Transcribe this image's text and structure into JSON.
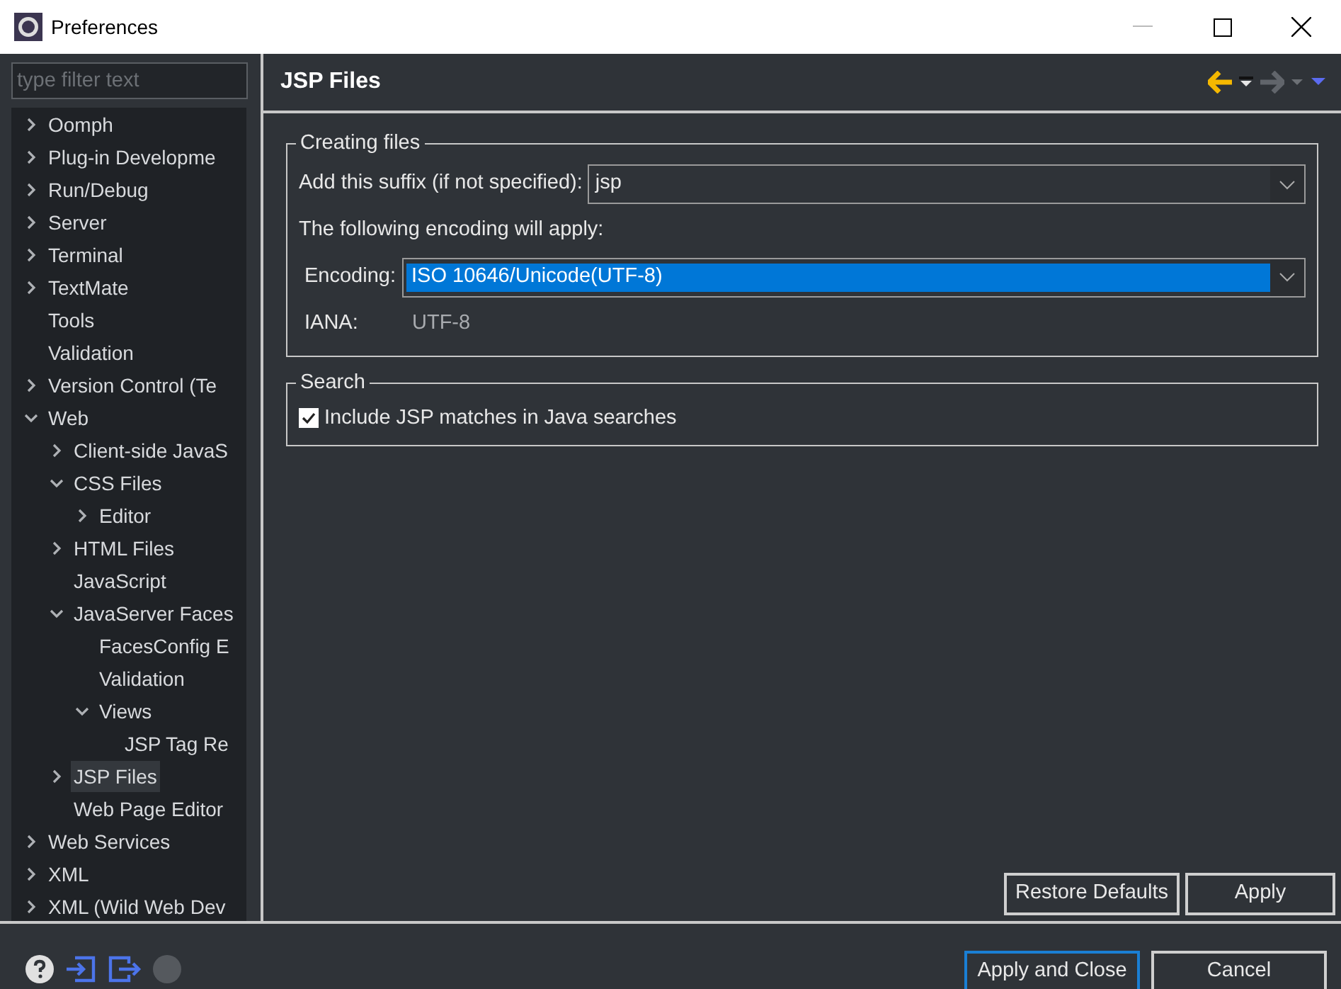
{
  "window": {
    "title": "Preferences"
  },
  "filter": {
    "placeholder": "type filter text"
  },
  "tree": [
    {
      "label": "Oomph",
      "expanded": false,
      "selected": false
    },
    {
      "label": "Plug-in Developme",
      "expanded": false,
      "selected": false
    },
    {
      "label": "Run/Debug",
      "expanded": false,
      "selected": false
    },
    {
      "label": "Server",
      "expanded": false,
      "selected": false
    },
    {
      "label": "Terminal",
      "expanded": false,
      "selected": false
    },
    {
      "label": "TextMate",
      "expanded": false,
      "selected": false
    },
    {
      "label": "Tools",
      "selected": false
    },
    {
      "label": "Validation",
      "selected": false
    },
    {
      "label": "Version Control (Te",
      "expanded": false,
      "selected": false
    },
    {
      "label": "Web",
      "expanded": true,
      "selected": false,
      "children": [
        {
          "label": "Client-side JavaS",
          "expanded": false,
          "selected": false
        },
        {
          "label": "CSS Files",
          "expanded": true,
          "selected": false,
          "children": [
            {
              "label": "Editor",
              "expanded": false,
              "selected": false
            }
          ]
        },
        {
          "label": "HTML Files",
          "expanded": false,
          "selected": false
        },
        {
          "label": "JavaScript",
          "selected": false
        },
        {
          "label": "JavaServer Faces",
          "expanded": true,
          "selected": false,
          "children": [
            {
              "label": "FacesConfig E",
              "selected": false
            },
            {
              "label": "Validation",
              "selected": false
            },
            {
              "label": "Views",
              "expanded": true,
              "selected": false,
              "children": [
                {
                  "label": "JSP Tag Re",
                  "selected": false
                }
              ]
            }
          ]
        },
        {
          "label": "JSP Files",
          "expanded": false,
          "selected": true
        },
        {
          "label": "Web Page Editor",
          "selected": false
        }
      ]
    },
    {
      "label": "Web Services",
      "expanded": false,
      "selected": false
    },
    {
      "label": "XML",
      "expanded": false,
      "selected": false
    },
    {
      "label": "XML (Wild Web Dev",
      "expanded": false,
      "selected": false
    }
  ],
  "page": {
    "title": "JSP Files",
    "creating_files": {
      "legend": "Creating files",
      "suffix_label": "Add this suffix (if not specified):",
      "suffix_value": "jsp",
      "encoding_note": "The following encoding will apply:",
      "encoding_label": "Encoding:",
      "encoding_value": "ISO 10646/Unicode(UTF-8)",
      "iana_label": "IANA:",
      "iana_value": "UTF-8"
    },
    "search": {
      "legend": "Search",
      "checkbox_label": "Include JSP matches in Java searches",
      "checked": true
    },
    "buttons": [
      "Restore Defaults",
      "Apply"
    ]
  },
  "dialog_buttons": [
    {
      "label": "Apply and Close",
      "default": true
    },
    {
      "label": "Cancel",
      "default": false
    }
  ]
}
